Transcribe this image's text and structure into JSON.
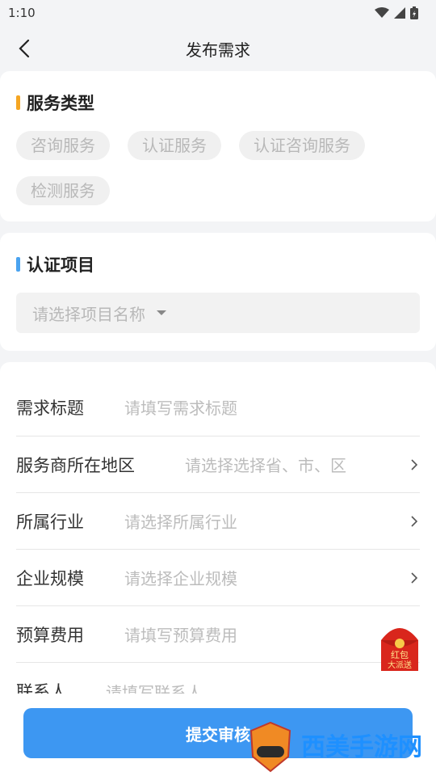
{
  "status_bar": {
    "time": "1:10"
  },
  "header": {
    "title": "发布需求"
  },
  "service_type": {
    "title": "服务类型",
    "accent_color": "#f5a623",
    "options": [
      "咨询服务",
      "认证服务",
      "认证咨询服务",
      "检测服务"
    ]
  },
  "cert_project": {
    "title": "认证项目",
    "accent_color": "#4aa3f0",
    "placeholder": "请选择项目名称"
  },
  "form": {
    "rows": [
      {
        "label": "需求标题",
        "placeholder": "请填写需求标题"
      },
      {
        "label": "服务商所在地区",
        "placeholder": "请选择选择省、市、区"
      },
      {
        "label": "所属行业",
        "placeholder": "请选择所属行业"
      },
      {
        "label": "企业规模",
        "placeholder": "请选择企业规模"
      },
      {
        "label": "预算费用",
        "placeholder": "请填写预算费用"
      },
      {
        "label": "联系人",
        "placeholder": "请填写联系人"
      }
    ]
  },
  "submit": {
    "label": "提交审核",
    "color": "#3d97f2"
  },
  "redpack": {
    "line1": "红包",
    "line2": "大派送"
  },
  "watermark": {
    "text": "西美手游网"
  }
}
